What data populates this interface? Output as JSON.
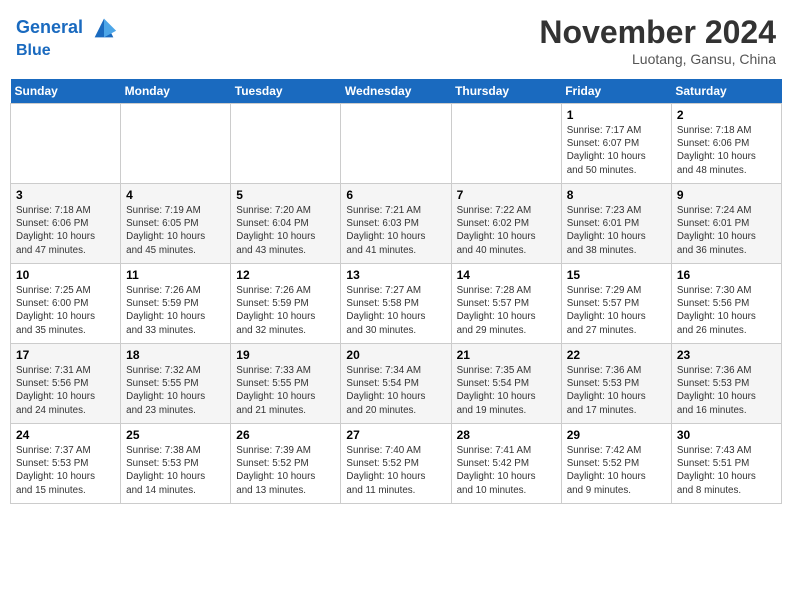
{
  "header": {
    "logo_line1": "General",
    "logo_line2": "Blue",
    "month_title": "November 2024",
    "location": "Luotang, Gansu, China"
  },
  "days_of_week": [
    "Sunday",
    "Monday",
    "Tuesday",
    "Wednesday",
    "Thursday",
    "Friday",
    "Saturday"
  ],
  "weeks": [
    [
      {
        "day": "",
        "info": ""
      },
      {
        "day": "",
        "info": ""
      },
      {
        "day": "",
        "info": ""
      },
      {
        "day": "",
        "info": ""
      },
      {
        "day": "",
        "info": ""
      },
      {
        "day": "1",
        "info": "Sunrise: 7:17 AM\nSunset: 6:07 PM\nDaylight: 10 hours\nand 50 minutes."
      },
      {
        "day": "2",
        "info": "Sunrise: 7:18 AM\nSunset: 6:06 PM\nDaylight: 10 hours\nand 48 minutes."
      }
    ],
    [
      {
        "day": "3",
        "info": "Sunrise: 7:18 AM\nSunset: 6:06 PM\nDaylight: 10 hours\nand 47 minutes."
      },
      {
        "day": "4",
        "info": "Sunrise: 7:19 AM\nSunset: 6:05 PM\nDaylight: 10 hours\nand 45 minutes."
      },
      {
        "day": "5",
        "info": "Sunrise: 7:20 AM\nSunset: 6:04 PM\nDaylight: 10 hours\nand 43 minutes."
      },
      {
        "day": "6",
        "info": "Sunrise: 7:21 AM\nSunset: 6:03 PM\nDaylight: 10 hours\nand 41 minutes."
      },
      {
        "day": "7",
        "info": "Sunrise: 7:22 AM\nSunset: 6:02 PM\nDaylight: 10 hours\nand 40 minutes."
      },
      {
        "day": "8",
        "info": "Sunrise: 7:23 AM\nSunset: 6:01 PM\nDaylight: 10 hours\nand 38 minutes."
      },
      {
        "day": "9",
        "info": "Sunrise: 7:24 AM\nSunset: 6:01 PM\nDaylight: 10 hours\nand 36 minutes."
      }
    ],
    [
      {
        "day": "10",
        "info": "Sunrise: 7:25 AM\nSunset: 6:00 PM\nDaylight: 10 hours\nand 35 minutes."
      },
      {
        "day": "11",
        "info": "Sunrise: 7:26 AM\nSunset: 5:59 PM\nDaylight: 10 hours\nand 33 minutes."
      },
      {
        "day": "12",
        "info": "Sunrise: 7:26 AM\nSunset: 5:59 PM\nDaylight: 10 hours\nand 32 minutes."
      },
      {
        "day": "13",
        "info": "Sunrise: 7:27 AM\nSunset: 5:58 PM\nDaylight: 10 hours\nand 30 minutes."
      },
      {
        "day": "14",
        "info": "Sunrise: 7:28 AM\nSunset: 5:57 PM\nDaylight: 10 hours\nand 29 minutes."
      },
      {
        "day": "15",
        "info": "Sunrise: 7:29 AM\nSunset: 5:57 PM\nDaylight: 10 hours\nand 27 minutes."
      },
      {
        "day": "16",
        "info": "Sunrise: 7:30 AM\nSunset: 5:56 PM\nDaylight: 10 hours\nand 26 minutes."
      }
    ],
    [
      {
        "day": "17",
        "info": "Sunrise: 7:31 AM\nSunset: 5:56 PM\nDaylight: 10 hours\nand 24 minutes."
      },
      {
        "day": "18",
        "info": "Sunrise: 7:32 AM\nSunset: 5:55 PM\nDaylight: 10 hours\nand 23 minutes."
      },
      {
        "day": "19",
        "info": "Sunrise: 7:33 AM\nSunset: 5:55 PM\nDaylight: 10 hours\nand 21 minutes."
      },
      {
        "day": "20",
        "info": "Sunrise: 7:34 AM\nSunset: 5:54 PM\nDaylight: 10 hours\nand 20 minutes."
      },
      {
        "day": "21",
        "info": "Sunrise: 7:35 AM\nSunset: 5:54 PM\nDaylight: 10 hours\nand 19 minutes."
      },
      {
        "day": "22",
        "info": "Sunrise: 7:36 AM\nSunset: 5:53 PM\nDaylight: 10 hours\nand 17 minutes."
      },
      {
        "day": "23",
        "info": "Sunrise: 7:36 AM\nSunset: 5:53 PM\nDaylight: 10 hours\nand 16 minutes."
      }
    ],
    [
      {
        "day": "24",
        "info": "Sunrise: 7:37 AM\nSunset: 5:53 PM\nDaylight: 10 hours\nand 15 minutes."
      },
      {
        "day": "25",
        "info": "Sunrise: 7:38 AM\nSunset: 5:53 PM\nDaylight: 10 hours\nand 14 minutes."
      },
      {
        "day": "26",
        "info": "Sunrise: 7:39 AM\nSunset: 5:52 PM\nDaylight: 10 hours\nand 13 minutes."
      },
      {
        "day": "27",
        "info": "Sunrise: 7:40 AM\nSunset: 5:52 PM\nDaylight: 10 hours\nand 11 minutes."
      },
      {
        "day": "28",
        "info": "Sunrise: 7:41 AM\nSunset: 5:42 PM\nDaylight: 10 hours\nand 10 minutes."
      },
      {
        "day": "29",
        "info": "Sunrise: 7:42 AM\nSunset: 5:52 PM\nDaylight: 10 hours\nand 9 minutes."
      },
      {
        "day": "30",
        "info": "Sunrise: 7:43 AM\nSunset: 5:51 PM\nDaylight: 10 hours\nand 8 minutes."
      }
    ]
  ]
}
